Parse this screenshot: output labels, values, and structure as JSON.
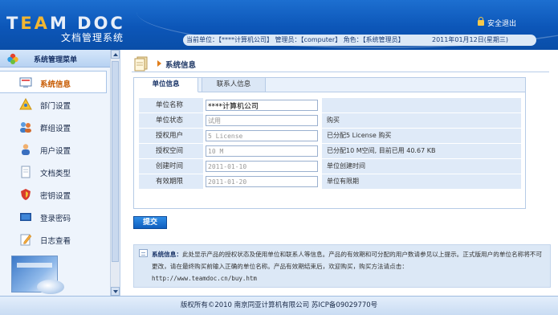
{
  "header": {
    "logo_en": "TEAM DOC",
    "logo_cn": "文档管理系统",
    "logout_label": "安全退出",
    "info_text": "当前单位：【****计算机公司】 管理员：【computer】 角色：【系统管理员】",
    "date_text": "2011年01月12日(星期三)"
  },
  "sidebar": {
    "title": "系统管理菜单",
    "items": [
      {
        "label": "系统信息",
        "icon": "monitor-icon"
      },
      {
        "label": "部门设置",
        "icon": "org-icon"
      },
      {
        "label": "群组设置",
        "icon": "group-icon"
      },
      {
        "label": "用户设置",
        "icon": "user-icon"
      },
      {
        "label": "文档类型",
        "icon": "document-icon"
      },
      {
        "label": "密钥设置",
        "icon": "shield-icon"
      },
      {
        "label": "登录密码",
        "icon": "screen-icon"
      },
      {
        "label": "日志查看",
        "icon": "edit-icon"
      }
    ],
    "active_index": 0
  },
  "main": {
    "breadcrumb": "系统信息",
    "tabs": [
      {
        "label": "单位信息"
      },
      {
        "label": "联系人信息"
      }
    ],
    "rows": [
      {
        "label": "单位名称",
        "value": "****计算机公司",
        "note": ""
      },
      {
        "label": "单位状态",
        "value": "试用",
        "note": "购买"
      },
      {
        "label": "授权用户",
        "value": "5 License",
        "note": "已分配5 License  购买"
      },
      {
        "label": "授权空间",
        "value": "10 M",
        "note": "已分配10 M空间, 目前已用 40.67 KB"
      },
      {
        "label": "创建时间",
        "value": "2011-01-10",
        "note": "单位创建时间"
      },
      {
        "label": "有效期限",
        "value": "2011-01-20",
        "note": "单位有限期"
      }
    ],
    "submit_label": "提交",
    "note_title": "系统信息：",
    "note_text": "此处显示产品的授权状态及使用单位和联系人等信息。产品的有效期和可分配的用户数请参见以上提示。正式版用户的单位名称将不可更改，请在最终购买前输入正确的单位名称。产品有效期结束后，欢迎购买，购买方法请点击：",
    "note_url": "http://www.teamdoc.cn/buy.htm"
  },
  "footer": {
    "text": "版权所有©2010  南京同亚计算机有限公司  苏ICP备09029770号"
  },
  "colors": {
    "header_blue": "#0c56b8",
    "active_menu_text": "#c75a00",
    "submit_blue": "#1f74d2"
  }
}
